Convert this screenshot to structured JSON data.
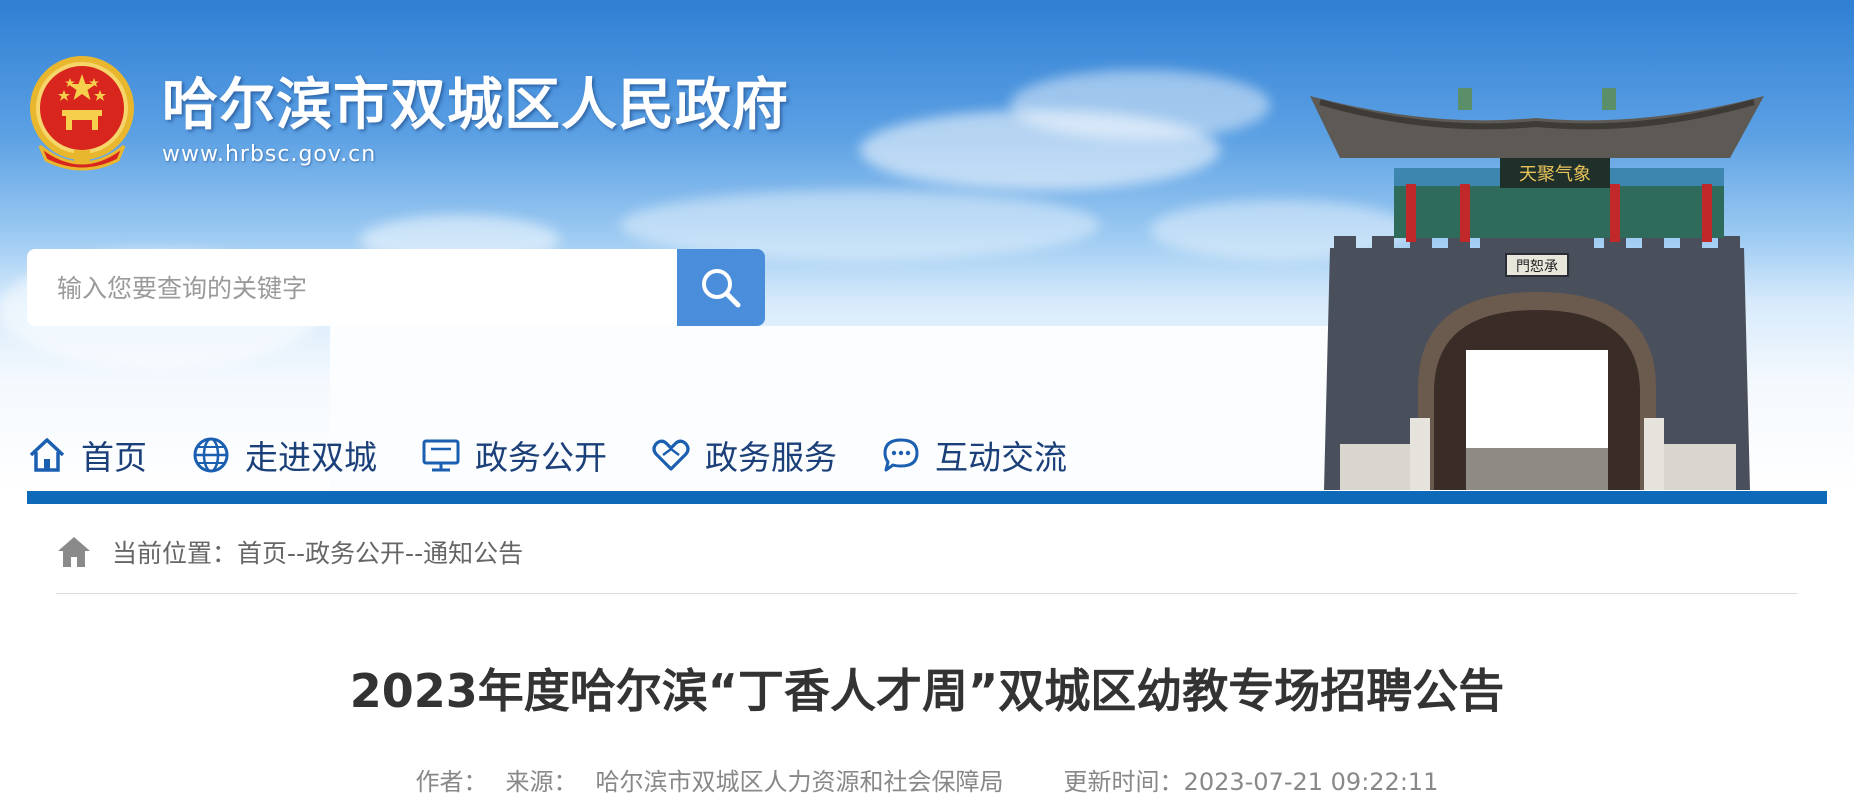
{
  "header": {
    "site_title": "哈尔滨市双城区人民政府",
    "site_url": "www.hrbsc.gov.cn",
    "emblem_icon": "national-emblem-icon",
    "gate_image": "gate-tower-image",
    "colors": {
      "sky": "#2f7fd4",
      "accent": "#0e6ab8",
      "search_button": "#4a8edb",
      "title_text": "#ffffff"
    }
  },
  "search": {
    "placeholder": "输入您要查询的关键字",
    "value": "",
    "button_icon": "search-icon"
  },
  "nav": {
    "items": [
      {
        "label": "首页",
        "icon": "home-icon"
      },
      {
        "label": "走进双城",
        "icon": "globe-icon"
      },
      {
        "label": "政务公开",
        "icon": "monitor-icon"
      },
      {
        "label": "政务服务",
        "icon": "heart-hands-icon"
      },
      {
        "label": "互动交流",
        "icon": "chat-bubble-icon"
      }
    ],
    "text_color": "#1b3f78"
  },
  "breadcrumb": {
    "icon": "home-solid-icon",
    "text": "当前位置：首页--政务公开--通知公告"
  },
  "article": {
    "title": "2023年度哈尔滨“丁香人才周”双城区幼教专场招聘公告",
    "author_label": "作者：",
    "source_label": "来源：",
    "source_value": "哈尔滨市双城区人力资源和社会保障局",
    "updated_label": "更新时间：",
    "updated_value": "2023-07-21 09:22:11"
  }
}
